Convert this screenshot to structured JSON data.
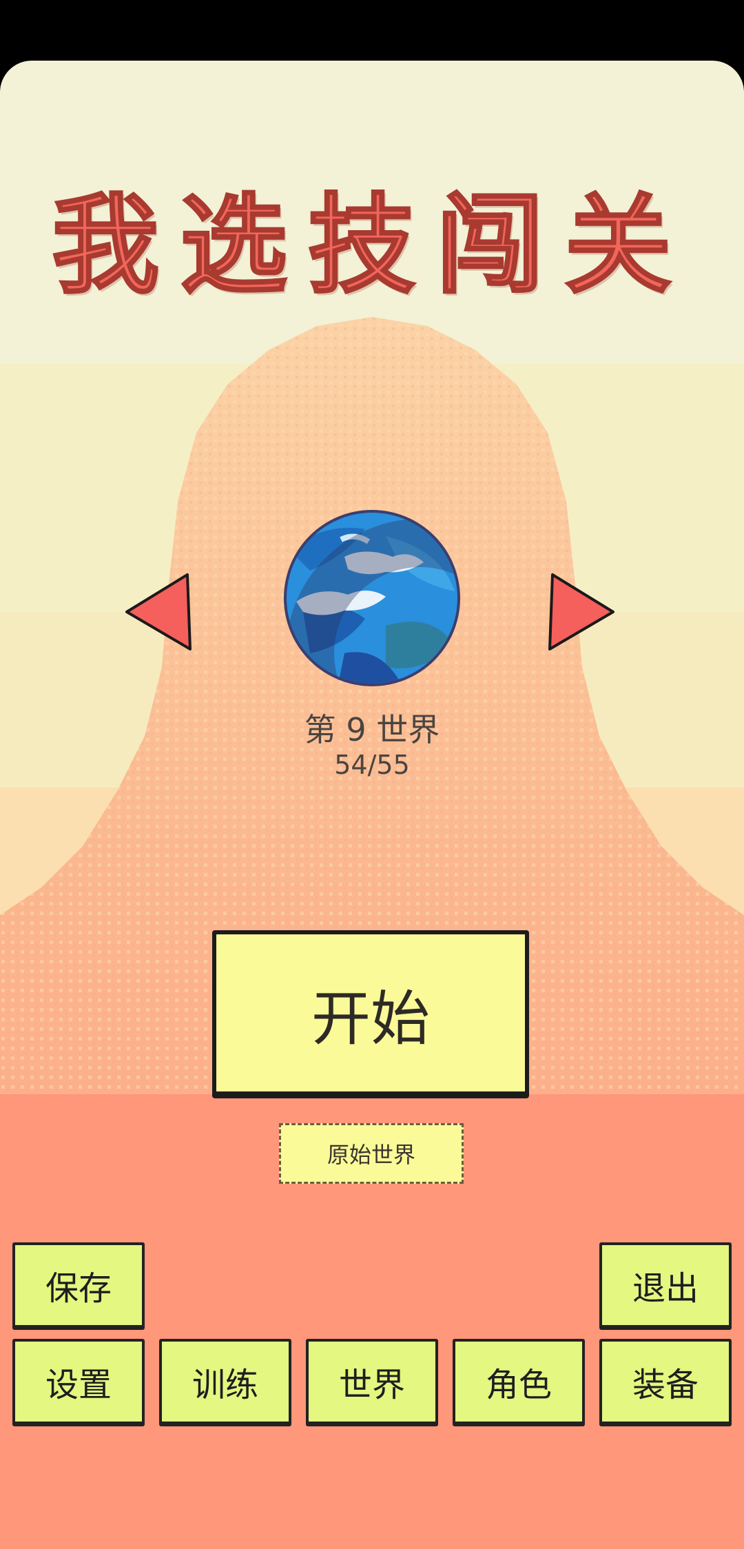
{
  "game": {
    "title": "我选技闯关"
  },
  "level_select": {
    "world_name": "第 9 世界",
    "world_progress": "54/55",
    "planet_icon": "earth-planet-icon",
    "prev_icon": "left-triangle-arrow-icon",
    "next_icon": "right-triangle-arrow-icon"
  },
  "actions": {
    "start_label": "开始",
    "mode_label": "原始世界"
  },
  "menu": {
    "save": "保存",
    "exit": "退出",
    "settings": "设置",
    "training": "训练",
    "world": "世界",
    "character": "角色",
    "equipment": "装备"
  },
  "colors": {
    "title": "#f2665c",
    "arrow": "#f55f5c",
    "start_button": "#fbfa99",
    "menu_button": "#e3f781",
    "background_bottom": "#ff977a"
  }
}
